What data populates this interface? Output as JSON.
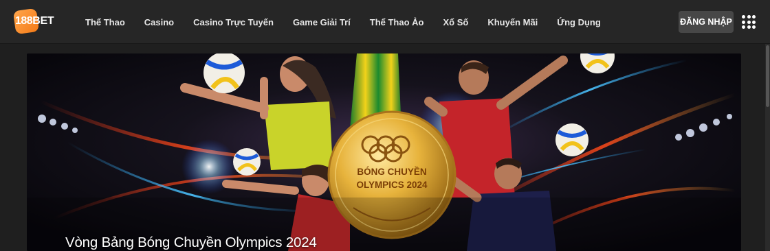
{
  "brand": {
    "number": "188",
    "name": "BET"
  },
  "nav": {
    "items": [
      {
        "label": "Thể Thao"
      },
      {
        "label": "Casino"
      },
      {
        "label": "Casino Trực Tuyến"
      },
      {
        "label": "Game Giải Trí"
      },
      {
        "label": "Thể Thao Ảo"
      },
      {
        "label": "Xổ Số"
      },
      {
        "label": "Khuyến Mãi"
      },
      {
        "label": "Ứng Dụng"
      }
    ]
  },
  "header": {
    "login_label": "ĐĂNG NHẬP",
    "menu_icon": "apps-grid-icon"
  },
  "banner": {
    "title": "Vòng Bảng Bóng Chuyền Olympics 2024",
    "medal_line1": "BÓNG CHUYỀN",
    "medal_line2": "OLYMPICS 2024"
  },
  "colors": {
    "header_bg": "#262626",
    "brand_orange": "#f47a16",
    "login_bg": "#474747",
    "page_bg": "#1f1f1f"
  }
}
